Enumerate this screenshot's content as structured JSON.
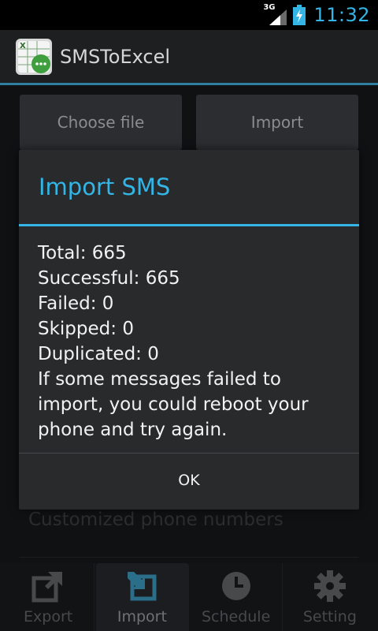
{
  "status_bar": {
    "network": "3G",
    "time": "11:32"
  },
  "app": {
    "title": "SMSToExcel",
    "icon": "sms-to-excel-app-icon"
  },
  "background": {
    "choose_file_label": "Choose file",
    "import_label": "Import",
    "customized_label": "Customized phone numbers"
  },
  "dialog": {
    "title": "Import SMS",
    "lines": [
      "Total: 665",
      "Successful: 665",
      "Failed: 0",
      "Skipped: 0",
      "Duplicated: 0",
      "If some messages failed to import, you could reboot your phone and try again."
    ],
    "ok_label": "OK"
  },
  "tabs": [
    {
      "label": "Export",
      "icon": "export-icon"
    },
    {
      "label": "Import",
      "icon": "import-icon"
    },
    {
      "label": "Schedule",
      "icon": "clock-icon"
    },
    {
      "label": "Setting",
      "icon": "gear-icon"
    }
  ],
  "colors": {
    "accent": "#33b5e5"
  }
}
